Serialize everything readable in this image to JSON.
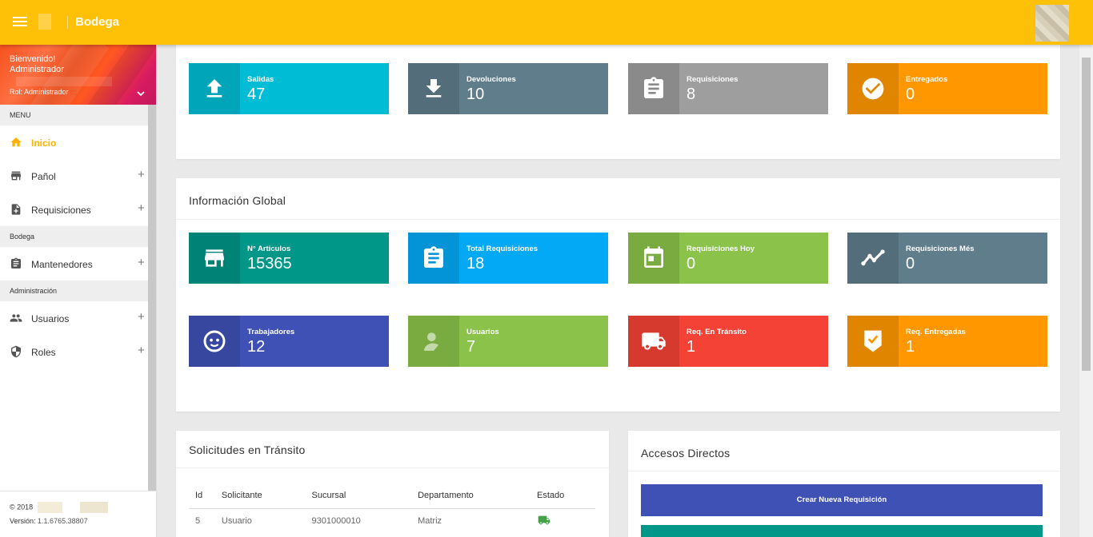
{
  "app": {
    "brand": "Bodega"
  },
  "user": {
    "welcome": "Bienvenido!",
    "name": "Administrador",
    "role": "Rol: Administrador"
  },
  "sidebar": {
    "menu_header": "MENU",
    "items_main": [
      {
        "label": "Inicio",
        "icon": "home-icon",
        "active": true
      },
      {
        "label": "Pañol",
        "icon": "store-icon"
      },
      {
        "label": "Requisiciones",
        "icon": "doc-add-icon"
      }
    ],
    "section_bodega": "Bodega",
    "items_bodega": [
      {
        "label": "Mantenedores",
        "icon": "clipboard-icon"
      }
    ],
    "section_admin": "Administración",
    "items_admin": [
      {
        "label": "Usuarios",
        "icon": "people-icon"
      },
      {
        "label": "Roles",
        "icon": "shield-icon"
      }
    ],
    "footer": {
      "copyright": "© 2018",
      "version_label": "Versión:",
      "version": "1.1.6765.38807"
    }
  },
  "top_tiles": [
    {
      "label": "Salidas",
      "value": "47",
      "color": "#00bcd4",
      "icon": "upload-icon"
    },
    {
      "label": "Devoluciones",
      "value": "10",
      "color": "#607d8b",
      "icon": "download-icon"
    },
    {
      "label": "Requisiciones",
      "value": "8",
      "color": "#9e9e9e",
      "icon": "clipboard-icon"
    },
    {
      "label": "Entregados",
      "value": "0",
      "color": "#ff9800",
      "icon": "check-circle-icon"
    }
  ],
  "global": {
    "title": "Información Global",
    "tiles": [
      {
        "label": "N° Articulos",
        "value": "15365",
        "color": "#009688",
        "icon": "store-icon"
      },
      {
        "label": "Total Requisiciones",
        "value": "18",
        "color": "#03a9f4",
        "icon": "clipboard-icon"
      },
      {
        "label": "Requisiciones Hoy",
        "value": "0",
        "color": "#8bc34a",
        "icon": "calendar-icon"
      },
      {
        "label": "Requisiciones Més",
        "value": "0",
        "color": "#607d8b",
        "icon": "trend-icon"
      },
      {
        "label": "Trabajadores",
        "value": "12",
        "color": "#3f51b5",
        "icon": "face-icon"
      },
      {
        "label": "Usuarios",
        "value": "7",
        "color": "#8bc34a",
        "icon": "person-icon"
      },
      {
        "label": "Req. En Tránsito",
        "value": "1",
        "color": "#f44336",
        "icon": "truck-icon"
      },
      {
        "label": "Req. Entregadas",
        "value": "1",
        "color": "#ff9800",
        "icon": "badge-check-icon"
      }
    ]
  },
  "transit": {
    "title": "Solicitudes en Tránsito",
    "columns": [
      "Id",
      "Solicitante",
      "Sucursal",
      "Departamento",
      "Estado"
    ],
    "rows": [
      {
        "id": "5",
        "solicitante": "Usuario",
        "sucursal": "9301000010",
        "departamento": "Matriz",
        "estado_icon": "truck-icon"
      }
    ]
  },
  "shortcuts": {
    "title": "Accesos Directos",
    "buttons": [
      {
        "label": "Crear Nueva Requisición",
        "color": "#3f51b5"
      },
      {
        "label": "",
        "color": "#009688"
      }
    ]
  }
}
